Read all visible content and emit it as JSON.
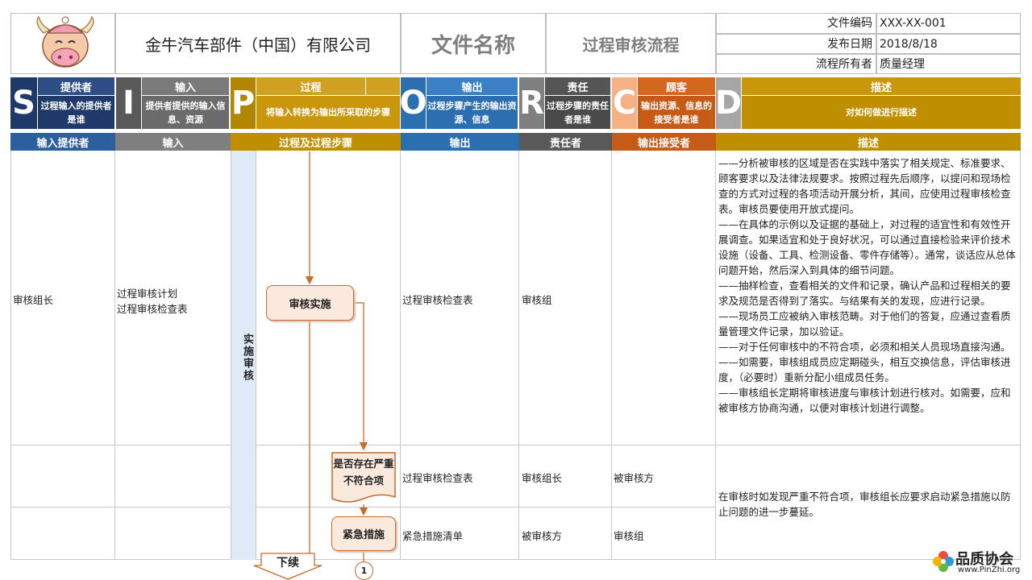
{
  "header": {
    "company": "金牛汽车部件（中国）有限公司",
    "doc_name_label": "文件名称",
    "doc_name": "过程审核流程",
    "meta": [
      {
        "label": "文件编码",
        "value": "XXX-XX-001"
      },
      {
        "label": "发布日期",
        "value": "2018/8/18"
      },
      {
        "label": "流程所有者",
        "value": "质量经理"
      }
    ]
  },
  "sipoc": [
    {
      "letter": "S",
      "title": "提供者",
      "desc": "过程输入的提供者是谁",
      "color": "#1f3a68"
    },
    {
      "letter": "I",
      "title": "输入",
      "desc": "提供者提供的输入信息、资源",
      "color": "#6b6b6b"
    },
    {
      "letter": "P",
      "title": "过程",
      "desc": "将输入转换为输出所采取的步骤",
      "color": "#c9960c"
    },
    {
      "letter": "O",
      "title": "输出",
      "desc": "过程步骤产生的输出资源、信息",
      "color": "#2c6fb0"
    },
    {
      "letter": "R",
      "title": "责任",
      "desc": "过程步骤的责任者是谁",
      "color": "#595959"
    },
    {
      "letter": "C",
      "title": "顾客",
      "desc": "输出资源、信息的接受者是谁",
      "color": "#c65a17"
    },
    {
      "letter": "D",
      "title": "描述",
      "desc": "对如何做进行描述",
      "color": "#bf8f00"
    }
  ],
  "columns": [
    "输入提供者",
    "输入",
    "过程及过程步骤",
    "输出",
    "责任者",
    "输出接受者",
    "描述"
  ],
  "phase_label": "实施审核",
  "rows": [
    {
      "supplier": "审核组长",
      "input": [
        "过程审核计划",
        "过程审核检查表"
      ],
      "step": "审核实施",
      "output": "过程审核检查表",
      "owner": "审核组",
      "receiver": "",
      "desc": [
        "——分析被审核的区域是否在实践中落实了相关规定、标准要求、顾客要求以及法律法规要求。按照过程先后顺序，以提问和现场检查的方式对过程的各项活动开展分析，其间，应使用过程审核检查表。审核员要使用开放式提问。",
        "——在具体的示例以及证据的基础上，对过程的适宜性和有效性开展调查。如果适宜和处于良好状况，可以通过直接检验来评价技术设施（设备、工具、检测设备、零件存储等）。通常，谈话应从总体问题开始，然后深入到具体的细节问题。",
        "——抽样检查，查看相关的文件和记录，确认产品和过程相关的要求及规范是否得到了落实。与结果有关的发现，应进行记录。",
        "——现场员工应被纳入审核范畴。对于他们的答复，应通过查看质量管理文件记录，加以验证。",
        "——对于任何审核中的不符合项，必须和相关人员现场直接沟通。",
        "——如需要，审核组成员应定期碰头，相互交换信息，评估审核进度，（必要时）重新分配小组成员任务。",
        "——审核组长定期将审核进度与审核计划进行核对。如需要，应和被审核方协商沟通，以便对审核计划进行调整。"
      ]
    },
    {
      "step": "是否存在严重不符合项",
      "output": "过程审核检查表",
      "owner": "审核组长",
      "receiver": "被审核方",
      "desc": "在审核时如发现严重不符合项，审核组长应要求启动紧急措施以防止问题的进一步蔓延。"
    },
    {
      "step": "紧急措施",
      "output": "紧急措施清单",
      "owner": "被审核方",
      "receiver": "审核组"
    }
  ],
  "continue_label": "下续",
  "connector_label": "1",
  "logo": {
    "name": "品质协会",
    "url": "www.PinZhi.org"
  }
}
